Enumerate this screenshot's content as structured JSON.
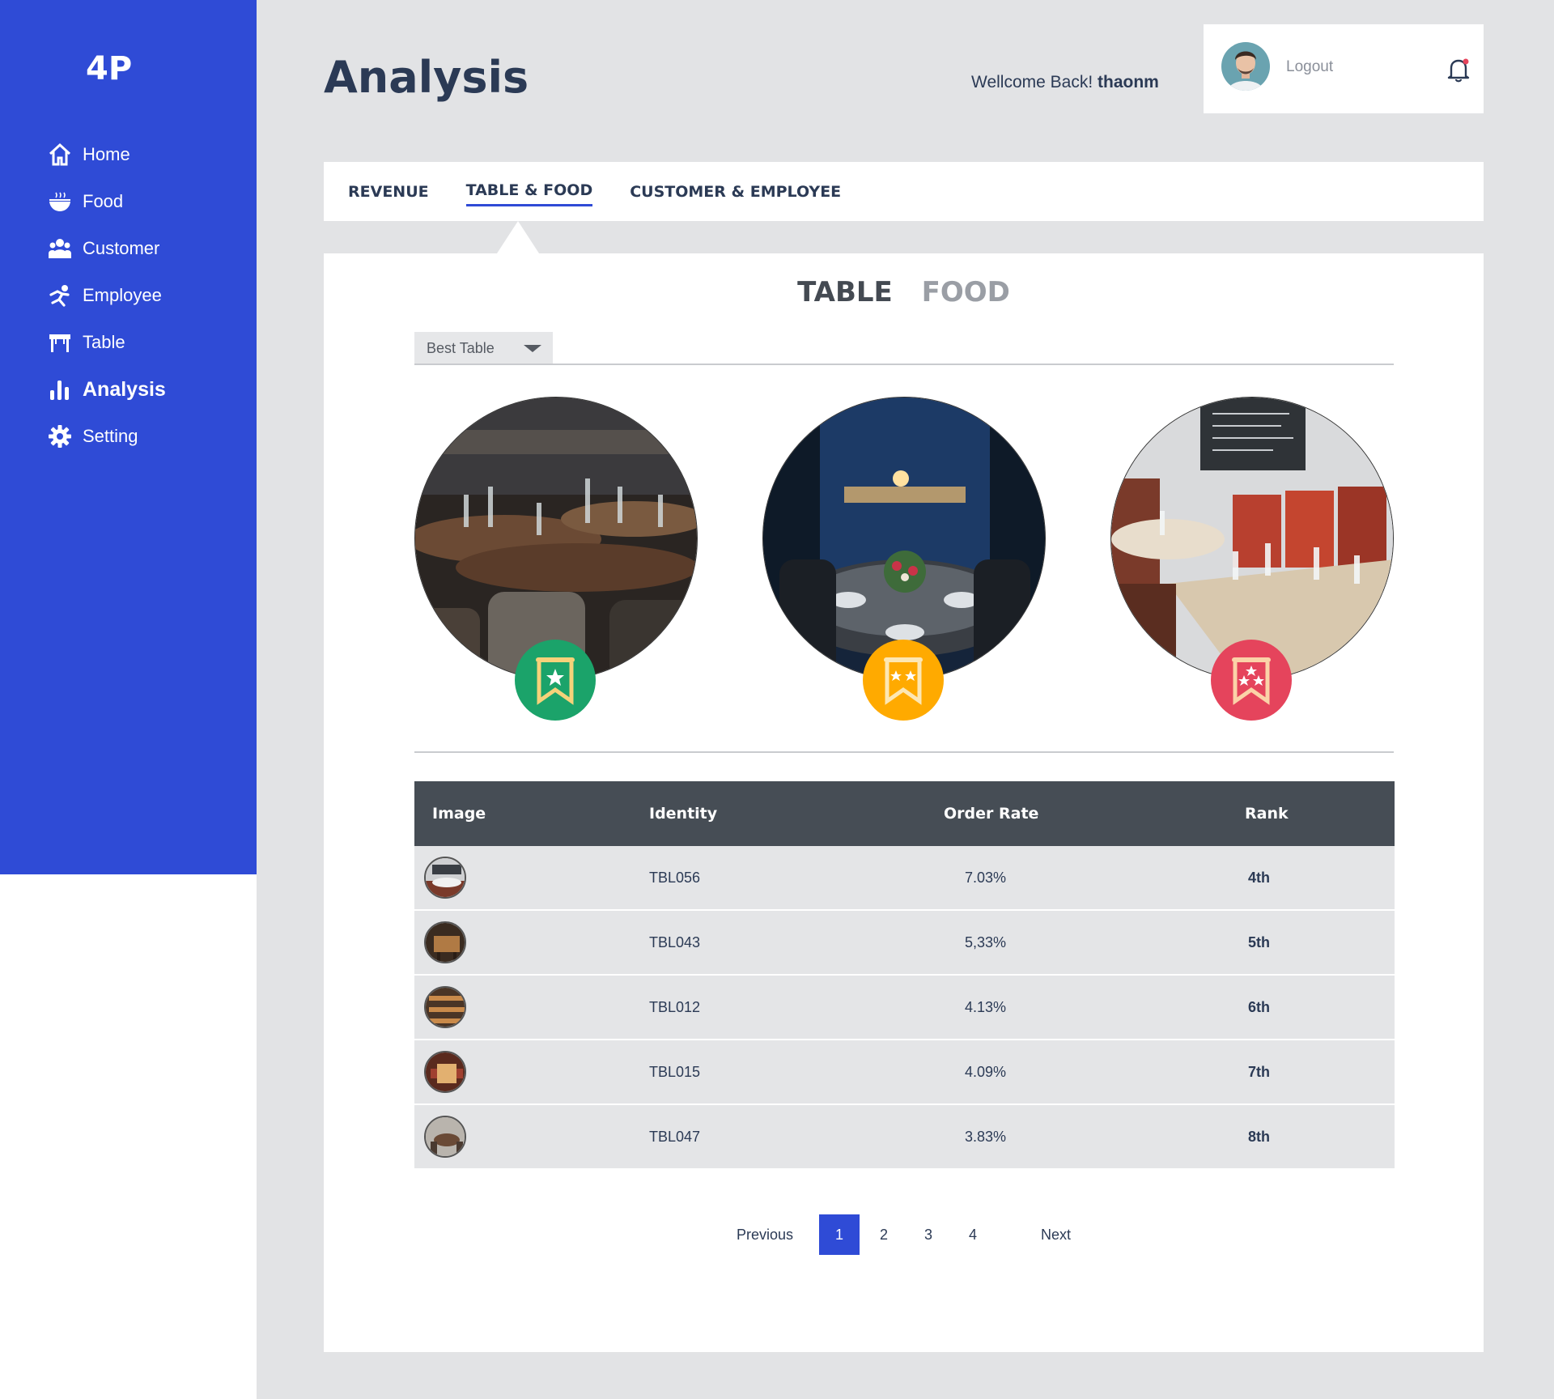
{
  "app": {
    "logo": "4P"
  },
  "sidebar": {
    "items": [
      {
        "label": "Home",
        "icon": "home-icon"
      },
      {
        "label": "Food",
        "icon": "food-bowl-icon"
      },
      {
        "label": "Customer",
        "icon": "customers-icon"
      },
      {
        "label": "Employee",
        "icon": "employee-icon"
      },
      {
        "label": "Table",
        "icon": "table-icon"
      },
      {
        "label": "Analysis",
        "icon": "bar-chart-icon",
        "active": true
      },
      {
        "label": "Setting",
        "icon": "gear-icon"
      }
    ]
  },
  "header": {
    "title": "Analysis",
    "welcome_prefix": "Wellcome Back!",
    "username": "thaonm",
    "logout": "Logout"
  },
  "tabs": [
    {
      "label": "REVENUE"
    },
    {
      "label": "TABLE & FOOD",
      "active": true
    },
    {
      "label": "CUSTOMER & EMPLOYEE"
    }
  ],
  "subtabs": [
    {
      "label": "TABLE",
      "active": true
    },
    {
      "label": "FOOD"
    }
  ],
  "dropdown": {
    "selected": "Best Table"
  },
  "podium": [
    {
      "medal": "1-star-ribbon-icon",
      "color": "#1ba36a",
      "stars": 1
    },
    {
      "medal": "2-star-ribbon-icon",
      "color": "#ffaa00",
      "stars": 2
    },
    {
      "medal": "3-star-ribbon-icon",
      "color": "#e5445c",
      "stars": 3
    }
  ],
  "table": {
    "headers": [
      "Image",
      "Identity",
      "Order Rate",
      "Rank"
    ],
    "rows": [
      {
        "identity": "TBL056",
        "rate": "7.03%",
        "rank": "4th"
      },
      {
        "identity": "TBL043",
        "rate": "5,33%",
        "rank": "5th"
      },
      {
        "identity": "TBL012",
        "rate": "4.13%",
        "rank": "6th"
      },
      {
        "identity": "TBL015",
        "rate": "4.09%",
        "rank": "7th"
      },
      {
        "identity": "TBL047",
        "rate": "3.83%",
        "rank": "8th"
      }
    ]
  },
  "pagination": {
    "previous": "Previous",
    "pages": [
      "1",
      "2",
      "3",
      "4"
    ],
    "current": "1",
    "next": "Next"
  },
  "colors": {
    "sidebar": "#2f4bd6",
    "accent": "#2f4bd6",
    "table_header": "#464d55",
    "gold": "#ffaa00",
    "green": "#1ba36a",
    "red": "#e5445c"
  }
}
